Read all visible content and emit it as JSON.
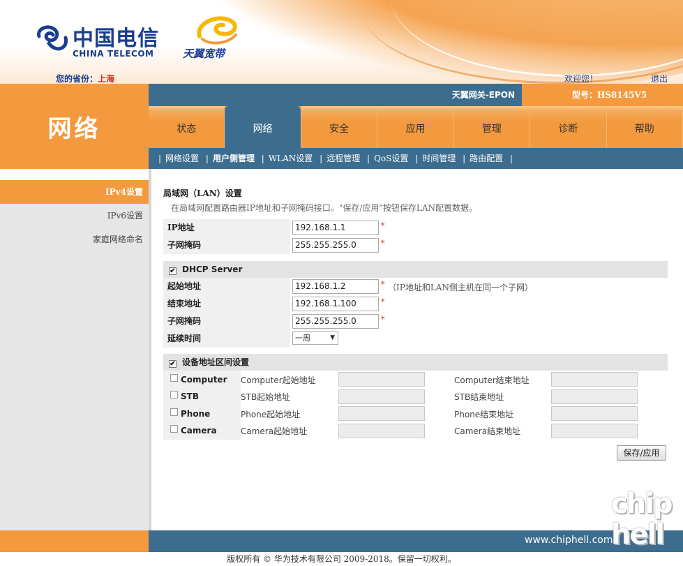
{
  "header": {
    "ct_name": "中国电信",
    "ct_name_en": "CHINA TELECOM",
    "ty_name": "天翼宽带",
    "province_label": "您的省份：",
    "province_value": "上海",
    "welcome": "欢迎您！",
    "logout": "退出"
  },
  "topbar": {
    "gateway": "天翼网关-EPON",
    "model": "型号：HS8145V5"
  },
  "section_title": "网络",
  "main_nav": [
    {
      "label": "状态"
    },
    {
      "label": "网络"
    },
    {
      "label": "安全"
    },
    {
      "label": "应用"
    },
    {
      "label": "管理"
    },
    {
      "label": "诊断"
    },
    {
      "label": "帮助"
    }
  ],
  "sub_nav": [
    {
      "label": "网络设置"
    },
    {
      "label": "用户侧管理"
    },
    {
      "label": "WLAN设置"
    },
    {
      "label": "远程管理"
    },
    {
      "label": "QoS设置"
    },
    {
      "label": "时间管理"
    },
    {
      "label": "路由配置"
    }
  ],
  "sidebar": [
    {
      "label": "IPv4设置"
    },
    {
      "label": "IPv6设置"
    },
    {
      "label": "家庭网络命名"
    }
  ],
  "lan": {
    "title": "局域网（LAN）设置",
    "desc": "在局域网配置路由器IP地址和子网掩码接口。\"保存/应用\"按钮保存LAN配置数据。",
    "ip_label": "IP地址",
    "ip_value": "192.168.1.1",
    "mask_label": "子网掩码",
    "mask_value": "255.255.255.0",
    "required": "*"
  },
  "dhcp": {
    "checkbox": "✔",
    "title": "DHCP Server",
    "start_label": "起始地址",
    "start_value": "192.168.1.2",
    "start_hint": "（IP地址和LAN侧主机在同一个子网）",
    "end_label": "结束地址",
    "end_value": "192.168.1.100",
    "mask_label": "子网掩码",
    "mask_value": "255.255.255.0",
    "lease_label": "延续时间",
    "lease_value": "一周",
    "lease_arrow": "▼"
  },
  "devices": {
    "checkbox": "✔",
    "title": "设备地址区间设置",
    "rows": [
      {
        "name": "Computer",
        "start_label": "Computer起始地址",
        "end_label": "Computer结束地址"
      },
      {
        "name": "STB",
        "start_label": "STB起始地址",
        "end_label": "STB结束地址"
      },
      {
        "name": "Phone",
        "start_label": "Phone起始地址",
        "end_label": "Phone结束地址"
      },
      {
        "name": "Camera",
        "start_label": "Camera起始地址",
        "end_label": "Camera结束地址"
      }
    ]
  },
  "save_button": "保存/应用",
  "footer": {
    "copyright": "版权所有 © 华为技术有限公司 2009-2018。保留一切权利。"
  },
  "watermark": {
    "url": "www.chiphell.com",
    "logo_top": "chip",
    "logo_bottom": "hell"
  }
}
